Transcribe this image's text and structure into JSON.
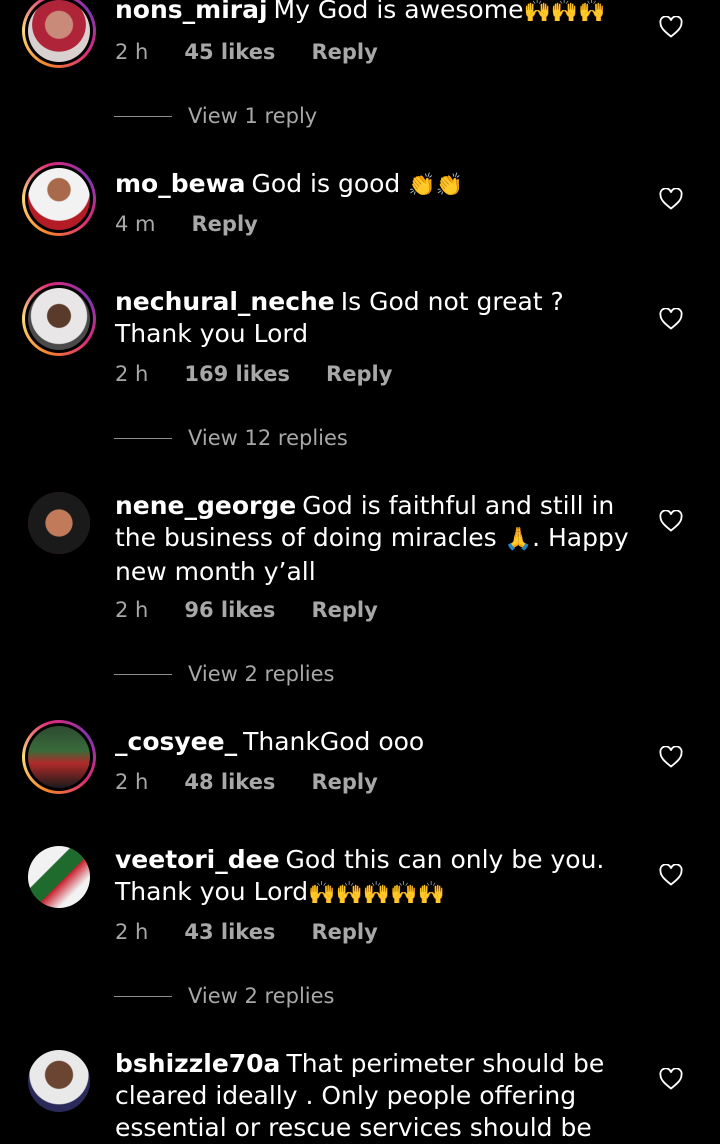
{
  "comments": [
    {
      "user": "nons_miraj",
      "text": "My God is awesome",
      "emoji": "🙌🙌🙌",
      "time": "2 h",
      "likes": "45 likes",
      "reply": "Reply",
      "view_replies": "View 1 reply"
    },
    {
      "user": "mo_bewa",
      "text": "God is good",
      "emoji": "👏👏",
      "time": "4 m",
      "likes": "",
      "reply": "Reply"
    },
    {
      "user": "nechural_neche",
      "text": "Is God not great ? Thank you Lord",
      "emoji": "",
      "time": "2 h",
      "likes": "169 likes",
      "reply": "Reply",
      "view_replies": "View 12 replies"
    },
    {
      "user": "nene_george",
      "text": "God is faithful and still in the business of doing miracles",
      "emoji": "🙏",
      "text_after": ". Happy new month y’all",
      "time": "2 h",
      "likes": "96 likes",
      "reply": "Reply",
      "view_replies": "View 2 replies"
    },
    {
      "user": "_cosyee_",
      "text": "ThankGod ooo",
      "time": "2 h",
      "likes": "48 likes",
      "reply": "Reply"
    },
    {
      "user": "veetori_dee",
      "text": "God this can only be you. Thank you Lord",
      "emoji": "🙌🙌🙌🙌🙌",
      "time": "2 h",
      "likes": "43 likes",
      "reply": "Reply",
      "view_replies": "View 2 replies"
    },
    {
      "user": "bshizzle70a",
      "text": "That perimeter should be cleared ideally . Only people offering essential or rescue  services should be"
    }
  ],
  "icons": {
    "like": "heart-outline-icon"
  },
  "colors": {
    "background": "#000000",
    "meta": "#a8a8a8",
    "story_ring_start": "#f58529",
    "story_ring_end": "#dd2a7b"
  }
}
